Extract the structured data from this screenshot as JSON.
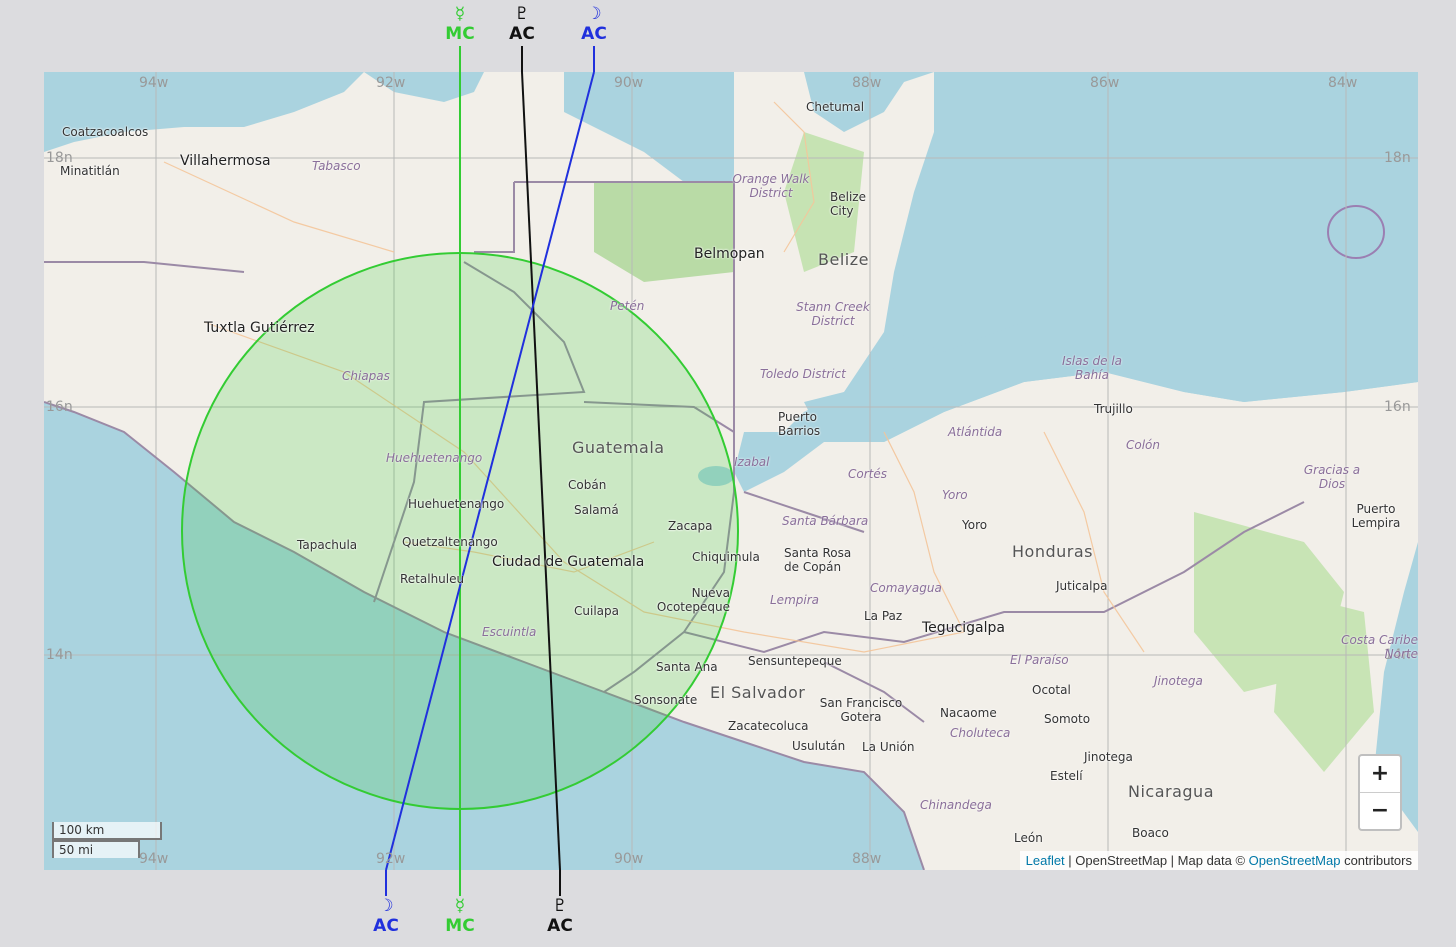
{
  "colors": {
    "mercury": "#33cc33",
    "moon": "#2030dd",
    "pluto": "#111111",
    "circle": "#33cc33"
  },
  "line_labels": {
    "top": [
      {
        "planet": "☿",
        "angle": "MC",
        "kind": "mercury"
      },
      {
        "planet": "♇",
        "angle": "AC",
        "kind": "pluto"
      },
      {
        "planet": "☽",
        "angle": "AC",
        "kind": "moon"
      }
    ],
    "bottom": [
      {
        "planet": "☽",
        "angle": "AC",
        "kind": "moon"
      },
      {
        "planet": "☿",
        "angle": "MC",
        "kind": "mercury"
      },
      {
        "planet": "♇",
        "angle": "AC",
        "kind": "pluto"
      }
    ]
  },
  "grid": {
    "lon_top": [
      "94w",
      "92w",
      "90w",
      "88w",
      "86w",
      "84w"
    ],
    "lon_bottom": [
      "94w",
      "92w",
      "90w",
      "88w"
    ],
    "lat": [
      "18n",
      "16n",
      "14n"
    ]
  },
  "countries": [
    "Guatemala",
    "Belize",
    "Honduras",
    "El Salvador",
    "Nicaragua"
  ],
  "cities": [
    "Coatzacoalcos",
    "Minatitlán",
    "Villahermosa",
    "Tuxtla Gutiérrez",
    "Chetumal",
    "Belize City",
    "Belmopan",
    "Puerto Barrios",
    "Trujillo",
    "Cobán",
    "Salamá",
    "Huehuetenango",
    "Quetzaltenango",
    "Tapachula",
    "Retalhuleu",
    "Ciudad de Guatemala",
    "Zacapa",
    "Chiquimula",
    "Cuilapa",
    "Nueva Ocotepeque",
    "Santa Ana",
    "Sonsonate",
    "Santa Rosa de Copán",
    "Yoro",
    "Juticalpa",
    "La Paz",
    "Tegucigalpa",
    "Sensuntepeque",
    "Zacatecoluca",
    "San Francisco Gotera",
    "Usulután",
    "La Unión",
    "Ocotal",
    "Nacaome",
    "Somoto",
    "Jinotega",
    "Estelí",
    "Boaco",
    "Puerto Lempira",
    "León"
  ],
  "regions": [
    "Tabasco",
    "Chiapas",
    "Orange Walk District",
    "Petén",
    "Stann Creek District",
    "Toledo District",
    "Huehuetenango",
    "Izabal",
    "Escuintla",
    "Cortés",
    "Atlántida",
    "Colón",
    "Islas de la Bahía",
    "Yoro",
    "Santa Bárbara",
    "Lempira",
    "Comayagua",
    "El Paraíso",
    "Jinotega",
    "Choluteca",
    "Chinandega",
    "Gracias a Dios",
    "Costa Caribe Norte"
  ],
  "controls": {
    "zoom_in": "+",
    "zoom_out": "−"
  },
  "scale": {
    "km": "100 km",
    "mi": "50 mi"
  },
  "attribution": {
    "leaflet": "Leaflet",
    "sep1": " | OpenStreetMap | Map data © ",
    "osm": "OpenStreetMap",
    "tail": " contributors"
  }
}
